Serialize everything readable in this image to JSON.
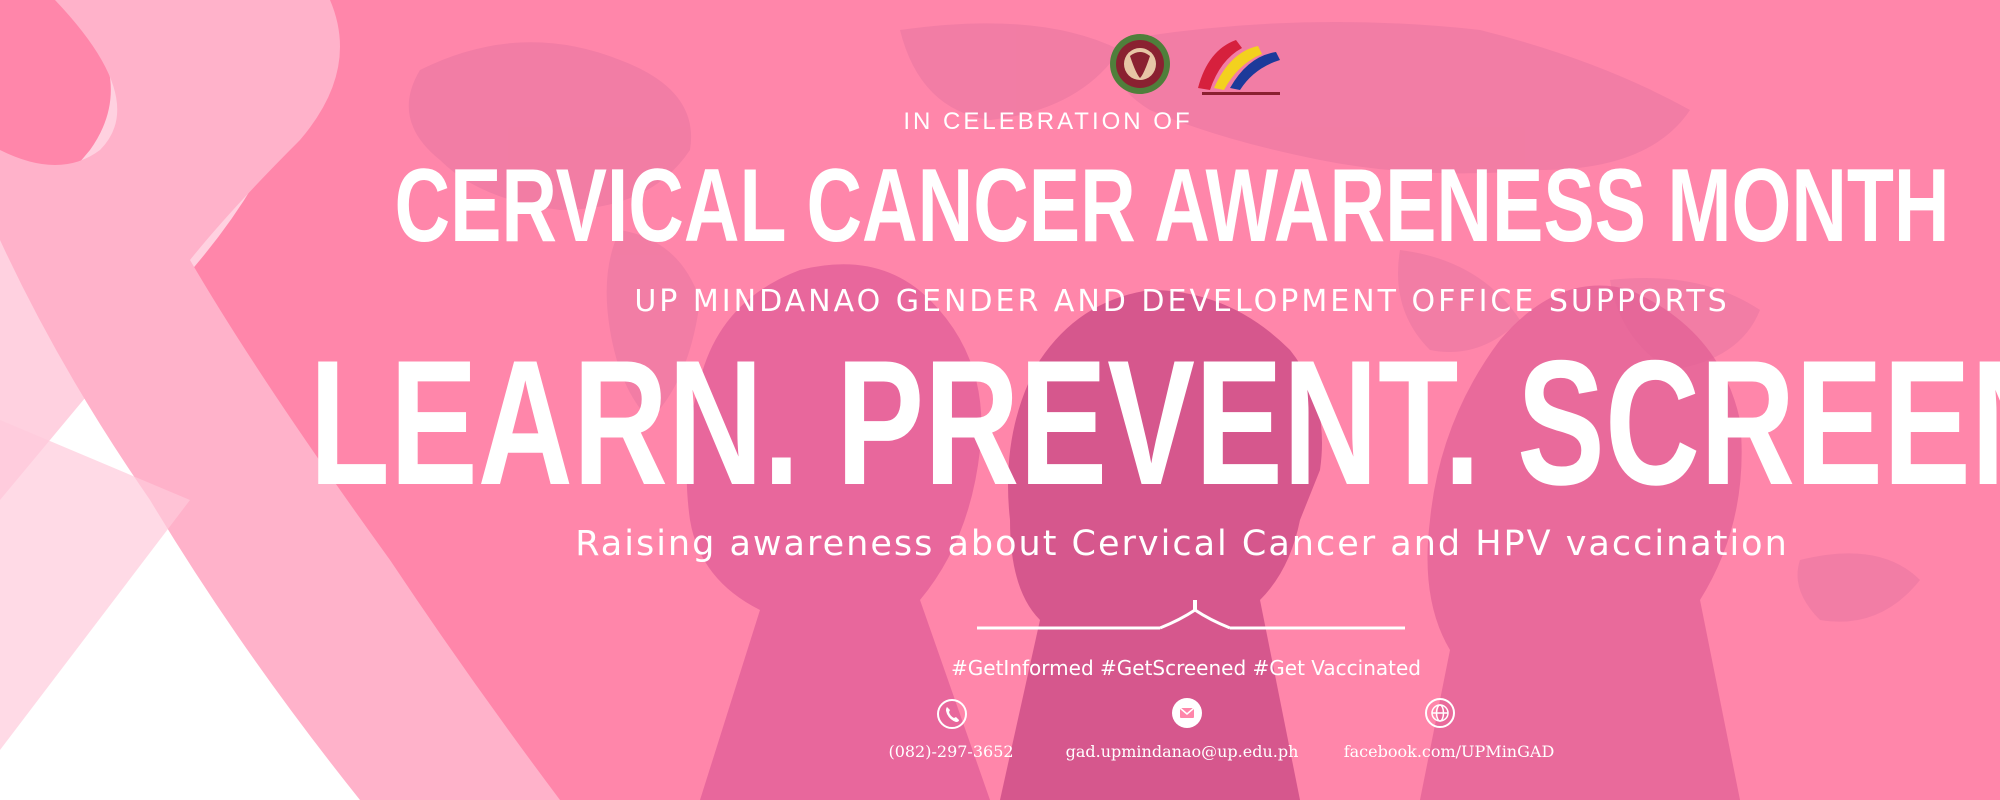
{
  "header": {
    "eyebrow": "IN CELEBRATION OF",
    "title": "CERVICAL CANCER AWARENESS MONTH",
    "supports": "UP MINDANAO GENDER AND DEVELOPMENT OFFICE SUPPORTS"
  },
  "slogan": "LEARN. PREVENT. SCREEN.",
  "subline": "Raising awareness about Cervical Cancer and HPV vaccination",
  "hashtags": "#GetInformed #GetScreened #Get Vaccinated",
  "contacts": [
    {
      "icon": "phone-icon",
      "value": "(082)-297-3652"
    },
    {
      "icon": "mail-icon",
      "value": "gad.upmindanao@up.edu.ph"
    },
    {
      "icon": "globe-icon",
      "value": "facebook.com/UPMinGAD"
    }
  ],
  "logos": [
    "university-seal",
    "gender-and-development-logo"
  ],
  "colors": {
    "background": "#ff86aa",
    "ribbon_light": "#ffd1e0",
    "ribbon_mid": "#ffb2ca",
    "silhouette": "#d65489",
    "text": "#ffffff"
  }
}
